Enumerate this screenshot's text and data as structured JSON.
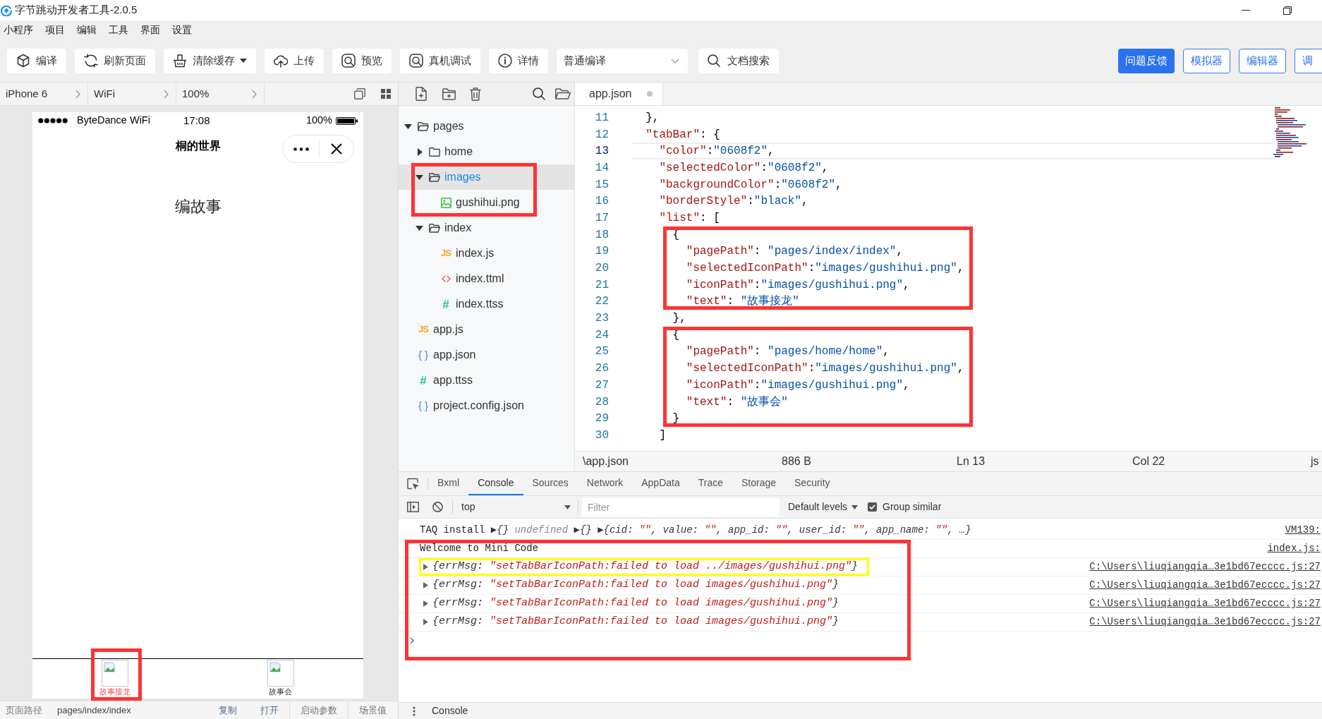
{
  "window": {
    "title": "字节跳动开发者工具-2.0.5"
  },
  "menu": [
    "小程序",
    "项目",
    "编辑",
    "工具",
    "界面",
    "设置"
  ],
  "toolbar": {
    "buttons": [
      {
        "kind": "compile",
        "label": "编译",
        "dropdown": false
      },
      {
        "kind": "refresh",
        "label": "刷新页面",
        "dropdown": false
      },
      {
        "kind": "clear",
        "label": "清除缓存",
        "dropdown": true
      },
      {
        "kind": "upload",
        "label": "上传",
        "dropdown": false
      },
      {
        "kind": "preview",
        "label": "预览",
        "dropdown": false
      },
      {
        "kind": "debug",
        "label": "真机调试",
        "dropdown": false
      },
      {
        "kind": "details",
        "label": "详情",
        "dropdown": false
      }
    ],
    "compile_mode": "普通编译",
    "doc_search": "文档搜索",
    "panel_buttons": [
      {
        "kind": "primary",
        "label": "问题反馈"
      },
      {
        "kind": "outline",
        "label": "模拟器"
      },
      {
        "kind": "outline",
        "label": "编辑器"
      },
      {
        "kind": "outline",
        "label": "调"
      }
    ]
  },
  "device_bar": {
    "device": "iPhone 6",
    "network": "WiFi",
    "zoom": "100%"
  },
  "simulator": {
    "status_bar": {
      "carrier": "ByteDance WiFi",
      "time": "17:08",
      "battery": "100%"
    },
    "nav_title": "桐的世界",
    "body_text": "编故事",
    "tab_bar": {
      "items": [
        {
          "label": "故事接龙",
          "selected": true,
          "annotated": true
        },
        {
          "label": "故事会",
          "selected": false,
          "annotated": false
        }
      ]
    }
  },
  "page_info": {
    "label": "页面路径",
    "path": "pages/index/index",
    "actions": [
      "复制",
      "打开"
    ],
    "fields": [
      "启动参数",
      "场景值"
    ]
  },
  "file_tree": {
    "items": [
      {
        "kind": "folder",
        "name": "pages",
        "expanded": true,
        "selected": false,
        "annotated": false,
        "children": [
          {
            "kind": "folder",
            "name": "home",
            "expanded": false,
            "selected": false,
            "annotated": false
          },
          {
            "kind": "folder",
            "name": "images",
            "expanded": true,
            "selected": true,
            "annotated": true,
            "children": [
              {
                "kind": "image",
                "name": "gushihui.png",
                "selected": false,
                "annotated": false
              }
            ]
          },
          {
            "kind": "folder",
            "name": "index",
            "expanded": true,
            "selected": false,
            "annotated": false,
            "children": [
              {
                "kind": "js",
                "glyph": "JS",
                "name": "index.js",
                "selected": false,
                "annotated": false
              },
              {
                "kind": "markup",
                "name": "index.ttml",
                "selected": false,
                "annotated": false
              },
              {
                "kind": "style",
                "glyph": "#",
                "name": "index.ttss",
                "selected": false,
                "annotated": false
              }
            ]
          }
        ]
      },
      {
        "kind": "js",
        "glyph": "JS",
        "name": "app.js",
        "selected": false,
        "annotated": false
      },
      {
        "kind": "json",
        "glyph": "{ }",
        "name": "app.json",
        "selected": false,
        "annotated": false
      },
      {
        "kind": "style",
        "glyph": "#",
        "name": "app.ttss",
        "selected": false,
        "annotated": false
      },
      {
        "kind": "json",
        "glyph": "{ }",
        "name": "project.config.json",
        "selected": false,
        "annotated": false
      }
    ]
  },
  "editor": {
    "tabs": [
      {
        "label": "app.json",
        "selected": true,
        "modified": true
      }
    ],
    "lines": [
      {
        "number": "11",
        "text": "  },",
        "current": false,
        "annotated": false
      },
      {
        "number": "12",
        "text": "  \"tabBar\": {",
        "current": false,
        "annotated": false
      },
      {
        "number": "13",
        "text": "    \"color\":\"0608f2\",",
        "current": true,
        "annotated": false
      },
      {
        "number": "14",
        "text": "    \"selectedColor\":\"0608f2\",",
        "current": false,
        "annotated": false
      },
      {
        "number": "15",
        "text": "    \"backgroundColor\":\"0608f2\",",
        "current": false,
        "annotated": false
      },
      {
        "number": "16",
        "text": "    \"borderStyle\":\"black\",",
        "current": false,
        "annotated": false
      },
      {
        "number": "17",
        "text": "    \"list\": [",
        "current": false,
        "annotated": false
      },
      {
        "number": "18",
        "text": "      {",
        "current": false,
        "annotated": true
      },
      {
        "number": "19",
        "text": "        \"pagePath\": \"pages/index/index\",",
        "current": false,
        "annotated": true
      },
      {
        "number": "20",
        "text": "        \"selectedIconPath\":\"images/gushihui.png\",",
        "current": false,
        "annotated": true
      },
      {
        "number": "21",
        "text": "        \"iconPath\":\"images/gushihui.png\",",
        "current": false,
        "annotated": true
      },
      {
        "number": "22",
        "text": "        \"text\": \"故事接龙\"",
        "current": false,
        "annotated": true
      },
      {
        "number": "23",
        "text": "      },",
        "current": false,
        "annotated": false
      },
      {
        "number": "24",
        "text": "      {",
        "current": false,
        "annotated": true
      },
      {
        "number": "25",
        "text": "        \"pagePath\": \"pages/home/home\",",
        "current": false,
        "annotated": true
      },
      {
        "number": "26",
        "text": "        \"selectedIconPath\":\"images/gushihui.png\",",
        "current": false,
        "annotated": true
      },
      {
        "number": "27",
        "text": "        \"iconPath\":\"images/gushihui.png\",",
        "current": false,
        "annotated": true
      },
      {
        "number": "28",
        "text": "        \"text\": \"故事会\"",
        "current": false,
        "annotated": true
      },
      {
        "number": "29",
        "text": "      }",
        "current": false,
        "annotated": true
      },
      {
        "number": "30",
        "text": "    ]",
        "current": false,
        "annotated": false
      }
    ],
    "status_bar": {
      "path": "\\app.json",
      "size": "886 B",
      "line": "Ln 13",
      "column": "Col 22",
      "language": "js"
    }
  },
  "console": {
    "tabs": [
      {
        "label": "Bxml",
        "selected": false
      },
      {
        "label": "Console",
        "selected": true
      },
      {
        "label": "Sources",
        "selected": false
      },
      {
        "label": "Network",
        "selected": false
      },
      {
        "label": "AppData",
        "selected": false
      },
      {
        "label": "Trace",
        "selected": false
      },
      {
        "label": "Storage",
        "selected": false
      },
      {
        "label": "Security",
        "selected": false
      }
    ],
    "context": "top",
    "filter_placeholder": "Filter",
    "levels": "Default levels",
    "group_similar": {
      "label": "Group similar",
      "checked": true
    },
    "output_annotated": true,
    "messages": [
      {
        "kind": "log",
        "highlighted": false,
        "parts": [
          {
            "kind": "plain",
            "text": "TAQ install "
          },
          {
            "kind": "object",
            "text": "▶{} "
          },
          {
            "kind": "undefined",
            "text": "undefined "
          },
          {
            "kind": "object",
            "text": "▶{} "
          },
          {
            "kind": "object",
            "text": "▶{cid: "
          },
          {
            "kind": "string",
            "text": "\"\""
          },
          {
            "kind": "object",
            "text": ", value: "
          },
          {
            "kind": "string",
            "text": "\"\""
          },
          {
            "kind": "object",
            "text": ", app_id: "
          },
          {
            "kind": "string",
            "text": "\"\""
          },
          {
            "kind": "object",
            "text": ", user_id: "
          },
          {
            "kind": "string",
            "text": "\"\""
          },
          {
            "kind": "object",
            "text": ", app_name: "
          },
          {
            "kind": "string",
            "text": "\"\""
          },
          {
            "kind": "object",
            "text": ", …}"
          }
        ],
        "source": "VM139:"
      },
      {
        "kind": "log",
        "highlighted": false,
        "parts": [
          {
            "kind": "plain",
            "text": "Welcome to Mini Code"
          }
        ],
        "source": "index.js:"
      },
      {
        "kind": "object",
        "highlighted": true,
        "parts": [
          {
            "kind": "object",
            "text": "{errMsg: "
          },
          {
            "kind": "string",
            "text": "\"setTabBarIconPath:failed to load ../images/gushihui.png\""
          },
          {
            "kind": "object",
            "text": "}"
          }
        ],
        "source": "C:\\Users\\liuqiangqia…3e1bd67ecccc.js:27"
      },
      {
        "kind": "object",
        "highlighted": false,
        "parts": [
          {
            "kind": "object",
            "text": "{errMsg: "
          },
          {
            "kind": "string",
            "text": "\"setTabBarIconPath:failed to load images/gushihui.png\""
          },
          {
            "kind": "object",
            "text": "}"
          }
        ],
        "source": "C:\\Users\\liuqiangqia…3e1bd67ecccc.js:27"
      },
      {
        "kind": "object",
        "highlighted": false,
        "parts": [
          {
            "kind": "object",
            "text": "{errMsg: "
          },
          {
            "kind": "string",
            "text": "\"setTabBarIconPath:failed to load images/gushihui.png\""
          },
          {
            "kind": "object",
            "text": "}"
          }
        ],
        "source": "C:\\Users\\liuqiangqia…3e1bd67ecccc.js:27"
      },
      {
        "kind": "object",
        "highlighted": false,
        "parts": [
          {
            "kind": "object",
            "text": "{errMsg: "
          },
          {
            "kind": "string",
            "text": "\"setTabBarIconPath:failed to load images/gushihui.png\""
          },
          {
            "kind": "object",
            "text": "}"
          }
        ],
        "source": "C:\\Users\\liuqiangqia…3e1bd67ecccc.js:27"
      }
    ],
    "drawer": {
      "tab": "Console"
    }
  }
}
